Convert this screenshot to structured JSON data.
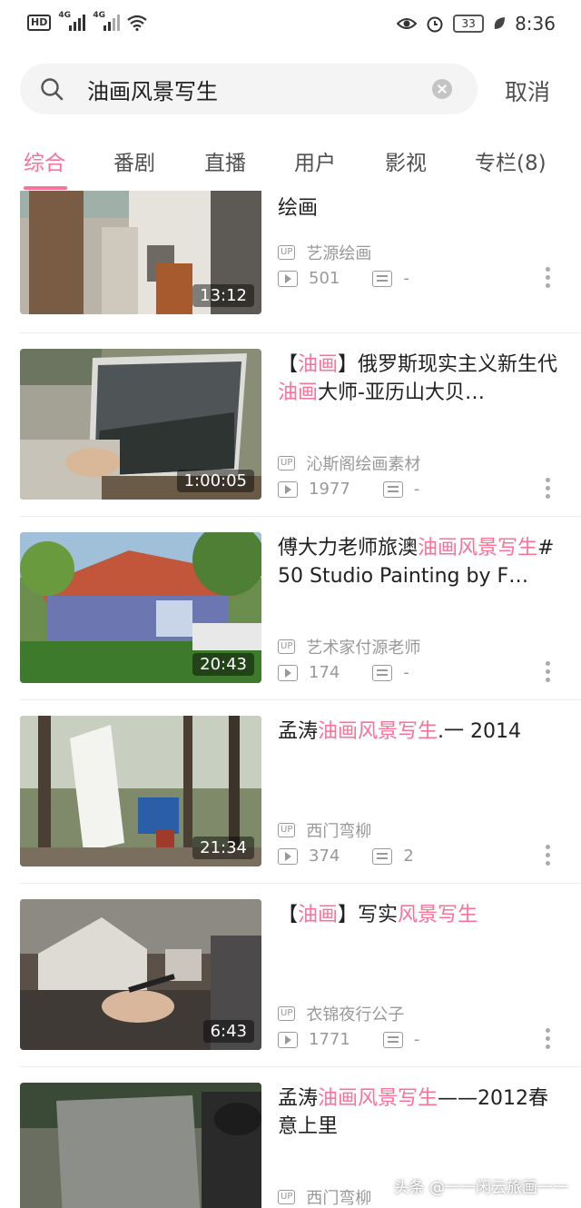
{
  "status_bar": {
    "left_icons": [
      "hd-icon",
      "signal-4g-icon",
      "signal-4g-icon",
      "wifi-icon"
    ],
    "hd": "HD",
    "net1": "4G",
    "net2": "4G",
    "battery": "33",
    "time": "8:36"
  },
  "search": {
    "query": "油画风景写生",
    "cancel_label": "取消"
  },
  "tabs": [
    {
      "label": "综合",
      "active": true
    },
    {
      "label": "番剧"
    },
    {
      "label": "直播"
    },
    {
      "label": "用户"
    },
    {
      "label": "影视"
    },
    {
      "label": "专栏(8)"
    }
  ],
  "videos": [
    {
      "title_parts": [
        {
          "t": "绘画",
          "hl": false
        }
      ],
      "up": "艺源绘画",
      "plays": "501",
      "danmaku": "-",
      "duration": "13:12"
    },
    {
      "title_parts": [
        {
          "t": "【",
          "hl": false
        },
        {
          "t": "油画",
          "hl": true
        },
        {
          "t": "】俄罗斯现实主义新生代",
          "hl": false
        },
        {
          "t": "油画",
          "hl": true
        },
        {
          "t": "大师-亚历山大贝…",
          "hl": false
        }
      ],
      "up": "沁斯阁绘画素材",
      "plays": "1977",
      "danmaku": "-",
      "duration": "1:00:05"
    },
    {
      "title_parts": [
        {
          "t": "傅大力老师旅澳",
          "hl": false
        },
        {
          "t": "油画风景写生",
          "hl": true
        },
        {
          "t": "#50 Studio Painting by F…",
          "hl": false
        }
      ],
      "up": "艺术家付源老师",
      "plays": "174",
      "danmaku": "-",
      "duration": "20:43"
    },
    {
      "title_parts": [
        {
          "t": "孟涛",
          "hl": false
        },
        {
          "t": "油画风景写生",
          "hl": true
        },
        {
          "t": ".一 2014",
          "hl": false
        }
      ],
      "up": "西门弯柳",
      "plays": "374",
      "danmaku": "2",
      "duration": "21:34"
    },
    {
      "title_parts": [
        {
          "t": "【",
          "hl": false
        },
        {
          "t": "油画",
          "hl": true
        },
        {
          "t": "】写实",
          "hl": false
        },
        {
          "t": "风景写生",
          "hl": true
        }
      ],
      "up": "衣锦夜行公子",
      "plays": "1771",
      "danmaku": "-",
      "duration": "6:43"
    },
    {
      "title_parts": [
        {
          "t": "孟涛",
          "hl": false
        },
        {
          "t": "油画风景写生",
          "hl": true
        },
        {
          "t": "——2012春意上里",
          "hl": false
        }
      ],
      "up": "西门弯柳",
      "plays": "",
      "danmaku": "",
      "duration": ""
    }
  ],
  "watermark": "头条 @一一闲云旅画一一",
  "colors": {
    "accent": "#fb7299",
    "text": "#212121",
    "meta": "#999999"
  }
}
